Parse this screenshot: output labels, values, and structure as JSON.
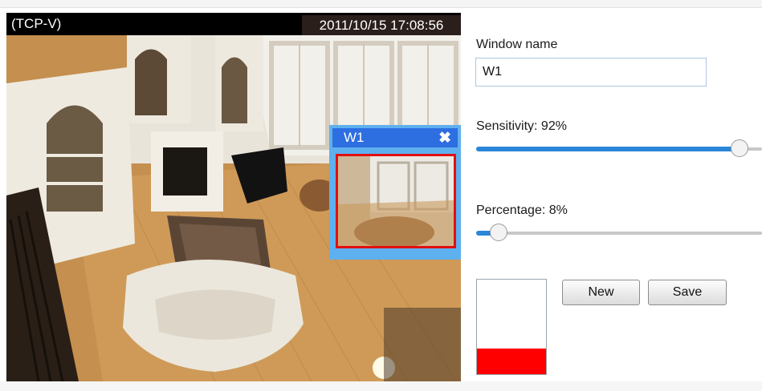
{
  "video": {
    "stream_label": "(TCP-V)",
    "timestamp": "2011/10/15  17:08:56"
  },
  "motion_window": {
    "name": "W1",
    "close_icon": "close-x-icon"
  },
  "window_name": {
    "label": "Window name",
    "value": "W1"
  },
  "sensitivity": {
    "label": "Sensitivity: 92%",
    "value": 92
  },
  "percentage": {
    "label": "Percentage: 8%",
    "value": 8
  },
  "activity_indicator": {
    "level": 0.27,
    "color": "#ff0000"
  },
  "buttons": {
    "new": "New",
    "save": "Save"
  },
  "colors": {
    "window_title": "#2d6ee0",
    "window_border": "#5fb0ee",
    "region_border": "#e01010",
    "slider_fill": "#2a86d8"
  }
}
